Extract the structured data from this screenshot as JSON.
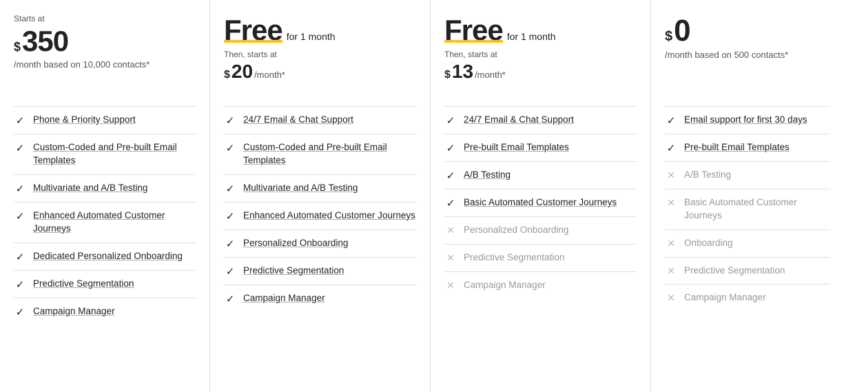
{
  "plans": [
    {
      "id": "enterprise",
      "starts_at_label": "Starts at",
      "dollar_sign": "$",
      "price": "350",
      "price_period": "/month based on 10,000 contacts*",
      "then_starts": null,
      "free_label": null,
      "features": [
        {
          "included": true,
          "text": "Phone & Priority Support"
        },
        {
          "included": true,
          "text": "Custom-Coded and Pre-built Email Templates"
        },
        {
          "included": true,
          "text": "Multivariate and A/B Testing"
        },
        {
          "included": true,
          "text": "Enhanced Automated Customer Journeys"
        },
        {
          "included": true,
          "text": "Dedicated Personalized Onboarding"
        },
        {
          "included": true,
          "text": "Predictive Segmentation"
        },
        {
          "included": true,
          "text": "Campaign Manager"
        }
      ]
    },
    {
      "id": "standard",
      "starts_at_label": null,
      "free_label": "Free",
      "for_label": "for 1 month",
      "then_starts": "Then, starts at",
      "then_dollar": "$",
      "then_price": "20",
      "then_period": "/month*",
      "features": [
        {
          "included": true,
          "text": "24/7 Email & Chat Support"
        },
        {
          "included": true,
          "text": "Custom-Coded and Pre-built Email Templates"
        },
        {
          "included": true,
          "text": "Multivariate and A/B Testing"
        },
        {
          "included": true,
          "text": "Enhanced Automated Customer Journeys"
        },
        {
          "included": true,
          "text": "Personalized Onboarding"
        },
        {
          "included": true,
          "text": "Predictive Segmentation"
        },
        {
          "included": true,
          "text": "Campaign Manager"
        }
      ]
    },
    {
      "id": "essentials",
      "starts_at_label": null,
      "free_label": "Free",
      "for_label": "for 1 month",
      "then_starts": "Then, starts at",
      "then_dollar": "$",
      "then_price": "13",
      "then_period": "/month*",
      "features": [
        {
          "included": true,
          "text": "24/7 Email & Chat Support"
        },
        {
          "included": true,
          "text": "Pre-built Email Templates"
        },
        {
          "included": true,
          "text": "A/B Testing"
        },
        {
          "included": true,
          "text": "Basic Automated Customer Journeys"
        },
        {
          "included": false,
          "text": "Personalized Onboarding"
        },
        {
          "included": false,
          "text": "Predictive Segmentation"
        },
        {
          "included": false,
          "text": "Campaign Manager"
        }
      ]
    },
    {
      "id": "free",
      "starts_at_label": null,
      "free_label": null,
      "zero_dollar": "$",
      "zero_price": "0",
      "price_period": "/month based on 500 contacts*",
      "features": [
        {
          "included": true,
          "text": "Email support for first 30 days"
        },
        {
          "included": true,
          "text": "Pre-built Email Templates"
        },
        {
          "included": false,
          "text": "A/B Testing"
        },
        {
          "included": false,
          "text": "Basic Automated Customer Journeys"
        },
        {
          "included": false,
          "text": "Onboarding"
        },
        {
          "included": false,
          "text": "Predictive Segmentation"
        },
        {
          "included": false,
          "text": "Campaign Manager"
        }
      ]
    }
  ]
}
